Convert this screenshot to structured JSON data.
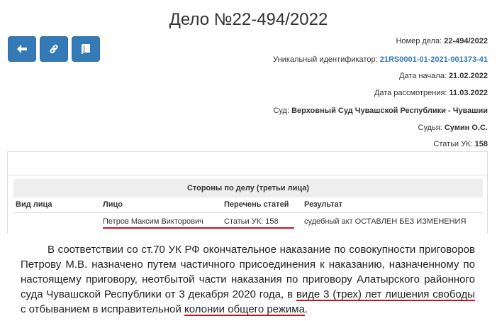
{
  "case": {
    "title": "Дело №22-494/2022"
  },
  "toolbar": {
    "back_icon": "arrow-left-icon",
    "link_icon": "link-icon",
    "book_icon": "book-icon"
  },
  "info": [
    {
      "label": "Номер дела:",
      "value": "22-494/2022",
      "link": false
    },
    {
      "label": "Уникальный идентификатор:",
      "value": "21RS0001-01-2021-001373-41",
      "link": true
    },
    {
      "label": "Дата начала:",
      "value": "21.02.2022",
      "link": false
    },
    {
      "label": "Дата рассмотрения:",
      "value": "11.03.2022",
      "link": false
    },
    {
      "label": "Суд:",
      "value": "Верховный Суд Чувашской Республики - Чувашии",
      "link": false
    },
    {
      "label": "Судья:",
      "value": "Сумин О.С.",
      "link": false
    },
    {
      "label": "Статьи УК:",
      "value": "158",
      "link": false
    }
  ],
  "parties": {
    "heading": "Стороны по делу (третьи лица)",
    "columns": [
      "Вид лица",
      "Лицо",
      "Перечень статей",
      "Результат"
    ],
    "rows": [
      {
        "type": "",
        "person": "Петров Максим Викторович",
        "articles": "Статьи УК: 158",
        "result": "судебный акт ОСТАВЛЕН БЕЗ ИЗМЕНЕНИЯ"
      }
    ]
  },
  "excerpt": {
    "part1": "В соответствии со ст.70 УК РФ окончательное наказание по совокупности приговоров Петрову М.В. назначено путем частичного присоединения к наказанию, назначенному по настоящему приговору, неотбытой части наказания по приговору Алатырского районного суда Чувашской Республики от 3 декабря 2020 года, в ",
    "hl1": "виде 3 (трех) лет лишения свободы",
    "part2": " с отбыванием в исправительной ",
    "hl2": "колонии общего режима",
    "part3": "."
  },
  "colors": {
    "button": "#337ab7",
    "link": "#337ab7",
    "highlight_underline": "#d01020"
  }
}
